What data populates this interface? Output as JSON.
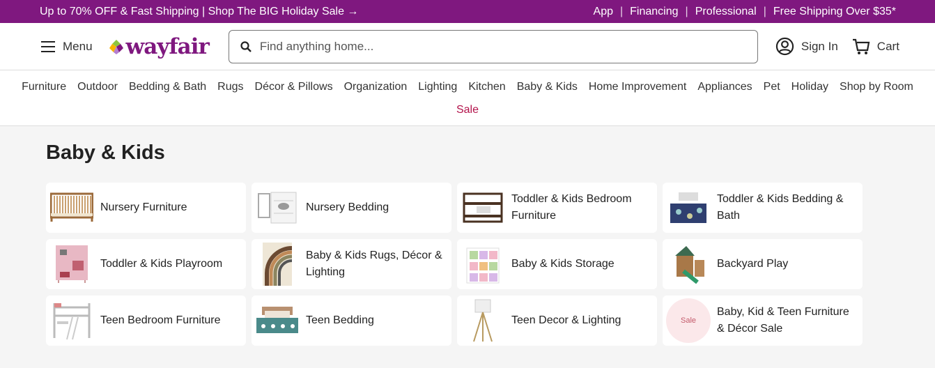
{
  "promo_bar": {
    "left_text": "Up to 70% OFF & Fast Shipping | Shop The BIG Holiday Sale →",
    "links": [
      "App",
      "Financing",
      "Professional",
      "Free Shipping Over $35*"
    ]
  },
  "header": {
    "menu_label": "Menu",
    "logo_text": "wayfair",
    "search_placeholder": "Find anything home...",
    "sign_in_label": "Sign In",
    "cart_label": "Cart"
  },
  "nav": {
    "items": [
      "Furniture",
      "Outdoor",
      "Bedding & Bath",
      "Rugs",
      "Décor & Pillows",
      "Organization",
      "Lighting",
      "Kitchen",
      "Baby & Kids",
      "Home Improvement",
      "Appliances",
      "Pet",
      "Holiday",
      "Shop by Room"
    ],
    "sale_label": "Sale",
    "sale_color": "#b3134b"
  },
  "page": {
    "title": "Baby & Kids",
    "categories": [
      {
        "label": "Nursery Furniture",
        "image": "crib"
      },
      {
        "label": "Nursery Bedding",
        "image": "nursery-bedding"
      },
      {
        "label": "Toddler & Kids Bedroom Furniture",
        "image": "bunk-bed"
      },
      {
        "label": "Toddler & Kids Bedding & Bath",
        "image": "kids-bedding"
      },
      {
        "label": "Toddler & Kids Playroom",
        "image": "play-kitchen"
      },
      {
        "label": "Baby & Kids Rugs, Décor & Lighting",
        "image": "rainbow-rug"
      },
      {
        "label": "Baby & Kids Storage",
        "image": "toy-storage"
      },
      {
        "label": "Backyard Play",
        "image": "playset"
      },
      {
        "label": "Teen Bedroom Furniture",
        "image": "loft-bed"
      },
      {
        "label": "Teen Bedding",
        "image": "teen-bedding"
      },
      {
        "label": "Teen Decor & Lighting",
        "image": "floor-lamp"
      },
      {
        "label": "Baby, Kid & Teen Furniture & Décor Sale",
        "image": "sale-badge",
        "badge": "Sale"
      }
    ]
  },
  "colors": {
    "brand": "#7f187f",
    "sale": "#b3134b"
  }
}
